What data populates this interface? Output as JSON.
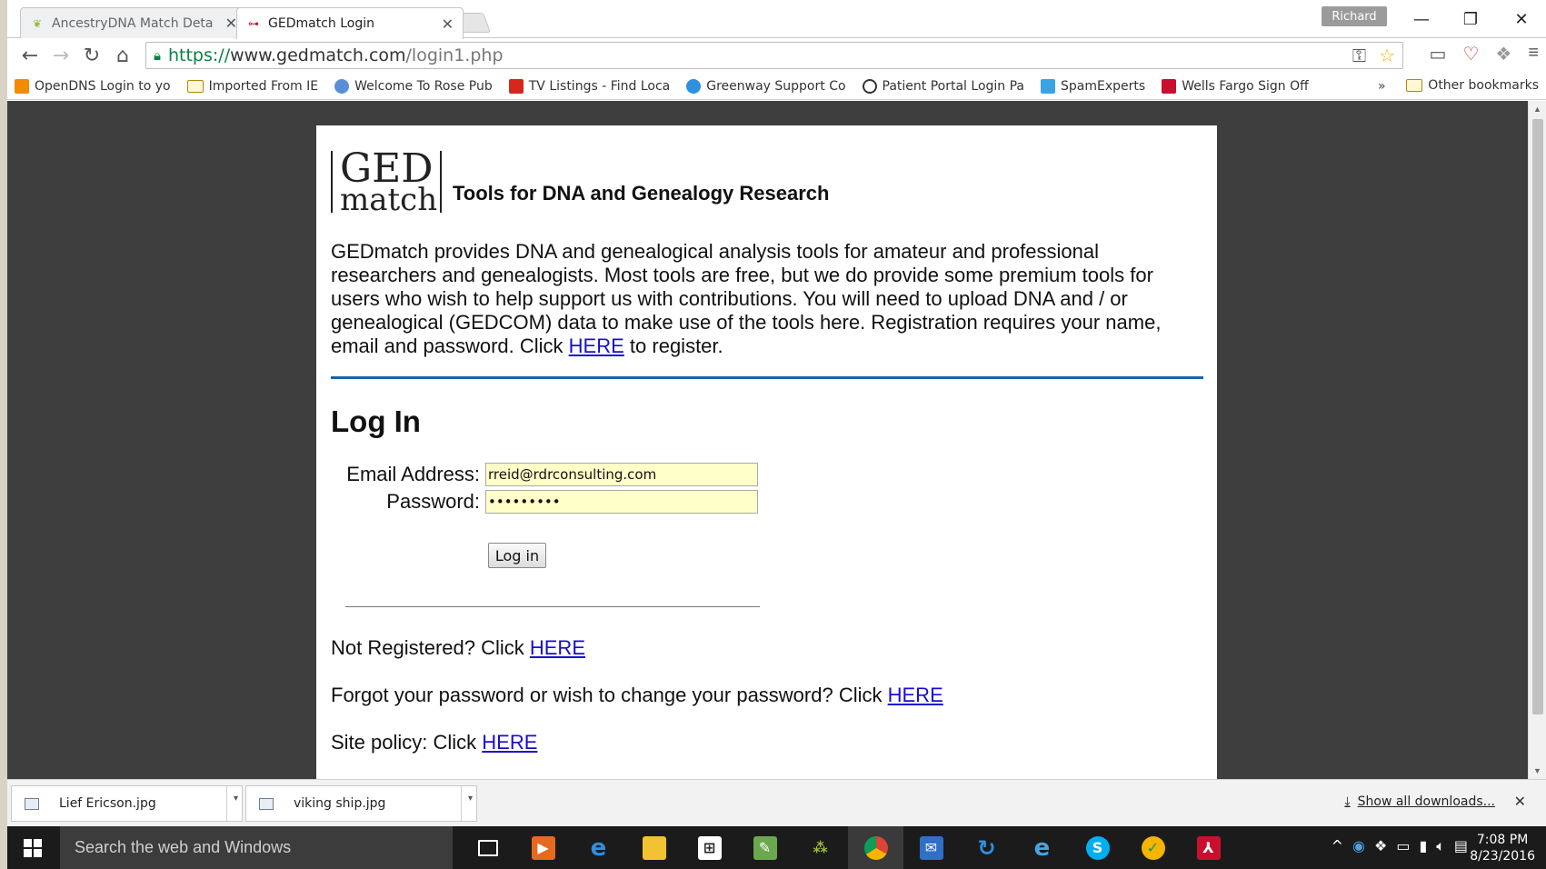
{
  "window": {
    "profile": "Richard",
    "tabs": [
      {
        "title": "AncestryDNA Match Deta",
        "active": false
      },
      {
        "title": "GEDmatch Login",
        "active": true
      }
    ]
  },
  "toolbar": {
    "url_scheme": "https://",
    "url_host": "www.gedmatch.com",
    "url_path": "/login1.php"
  },
  "bookmarks": {
    "items": [
      {
        "label": "OpenDNS Login to yo",
        "color": "#f48a00"
      },
      {
        "label": "Imported From IE",
        "folder": true
      },
      {
        "label": "Welcome To Rose Pub",
        "color": "#5a8fd8"
      },
      {
        "label": "TV Listings - Find Loca",
        "color": "#d7261e"
      },
      {
        "label": "Greenway Support Co",
        "color": "#2f8fe0"
      },
      {
        "label": "Patient Portal Login Pa",
        "color": "#333333"
      },
      {
        "label": "SpamExperts",
        "color": "#3aa3e3"
      },
      {
        "label": "Wells Fargo Sign Off",
        "color": "#c8102e"
      }
    ],
    "more": "»",
    "other": "Other bookmarks"
  },
  "page": {
    "logo_top": "GED",
    "logo_bottom": "match",
    "tagline": "Tools for DNA and Genealogy Research",
    "intro": "GEDmatch provides DNA and genealogical analysis tools for amateur and professional researchers and genealogists. Most tools are free, but we do provide some premium tools for users who wish to help support us with contributions. You will need to upload DNA and / or genealogical (GEDCOM) data to make use of the tools here. Registration requires your name, email and password. Click",
    "intro_link": "HERE",
    "intro_tail": "to register.",
    "login_heading": "Log In",
    "email_label": "Email Address:",
    "email_value": "rreid@rdrconsulting.com",
    "password_label": "Password:",
    "password_value": "•••••••••",
    "login_button": "Log in",
    "not_registered": "Not Registered? Click",
    "not_registered_link": "HERE",
    "forgot": "Forgot your password or wish to change your password? Click",
    "forgot_link": "HERE",
    "policy": "Site policy: Click",
    "policy_link": "HERE"
  },
  "downloads": {
    "items": [
      "Lief Ericson.jpg",
      "viking ship.jpg"
    ],
    "show_all": "Show all downloads..."
  },
  "taskbar": {
    "search_placeholder": "Search the web and Windows",
    "time": "7:08 PM",
    "date": "8/23/2016"
  },
  "colors": {
    "link": "#1a0dcc",
    "rule_blue": "#1565a8",
    "input_bg": "#ffffc8",
    "page_bg": "#3e3e3e"
  }
}
